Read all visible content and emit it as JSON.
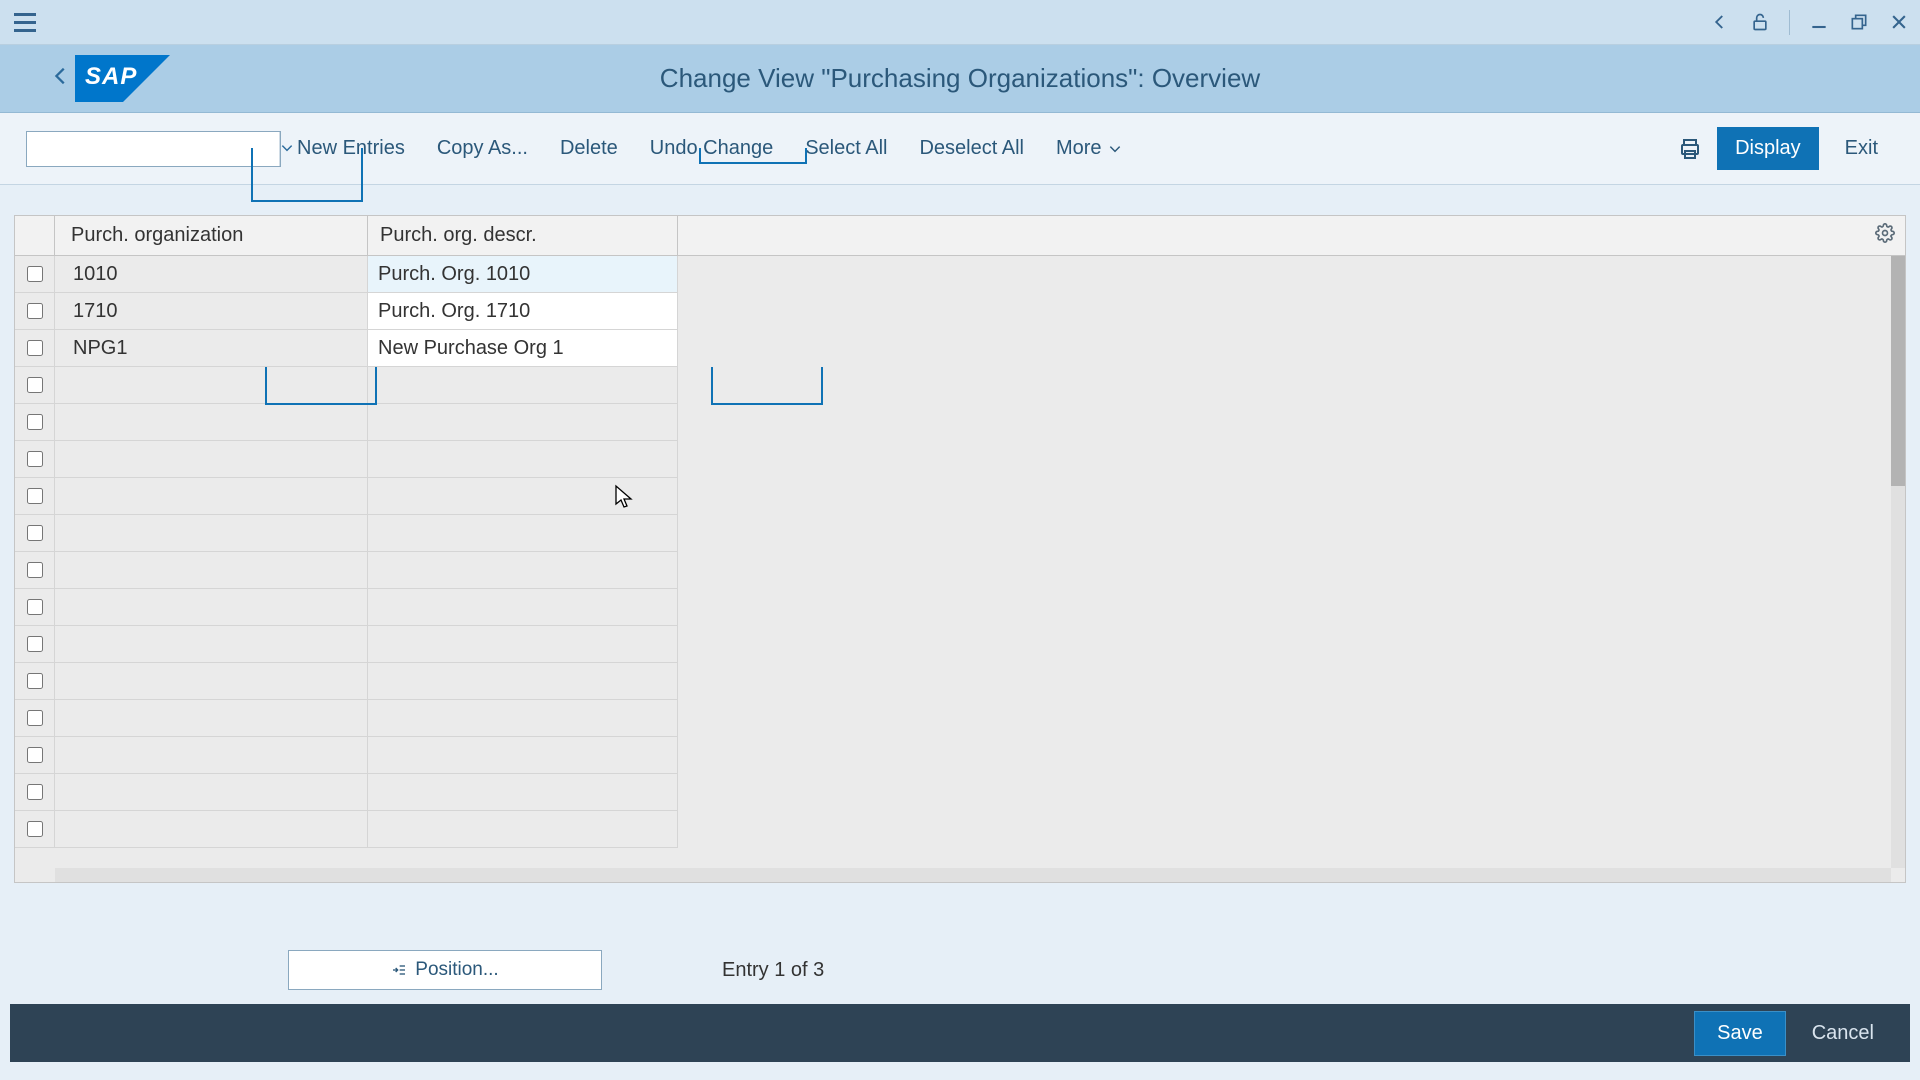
{
  "header": {
    "title": "Change View \"Purchasing Organizations\": Overview"
  },
  "toolbar": {
    "new_entries": "New Entries",
    "copy_as": "Copy As...",
    "delete": "Delete",
    "undo_change": "Undo Change",
    "select_all": "Select All",
    "deselect_all": "Deselect All",
    "more": "More",
    "display": "Display",
    "exit": "Exit"
  },
  "table": {
    "columns": {
      "org": "Purch. organization",
      "descr": "Purch. org. descr."
    },
    "rows": [
      {
        "org": "1010",
        "descr": "Purch. Org. 1010"
      },
      {
        "org": "1710",
        "descr": "Purch. Org. 1710"
      },
      {
        "org": "NPG1",
        "descr": "New Purchase Org 1"
      }
    ]
  },
  "bottom": {
    "position": "Position...",
    "entry": "Entry 1 of 3"
  },
  "footer": {
    "save": "Save",
    "cancel": "Cancel"
  }
}
